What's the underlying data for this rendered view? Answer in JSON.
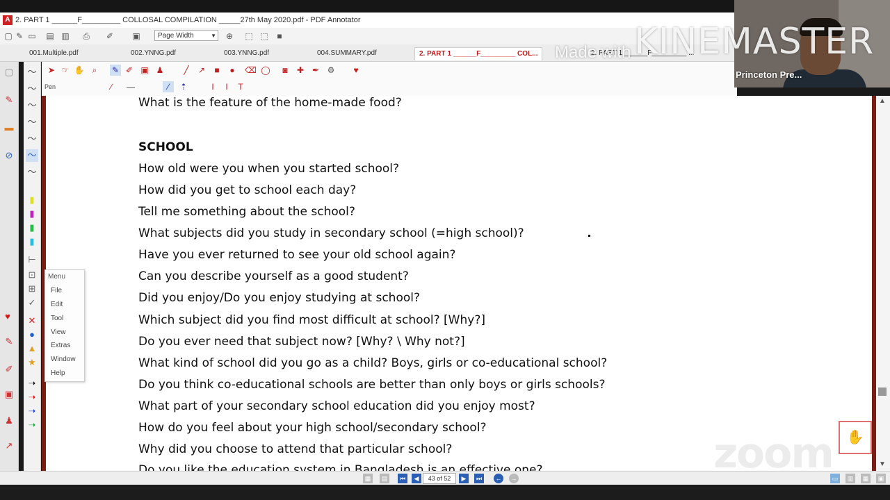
{
  "window": {
    "title": "2. PART 1 ______F_________ COLLOSAL COMPILATION _____27th  May  2020.pdf - PDF Annotator",
    "app_icon": "pdf-annotator-icon"
  },
  "quick_toolbar": {
    "zoom_mode": "Page Width"
  },
  "tabs": [
    {
      "label": "001.Multiple.pdf"
    },
    {
      "label": "002.YNNG.pdf"
    },
    {
      "label": "003.YNNG.pdf"
    },
    {
      "label": "004.SUMMARY.pdf"
    },
    {
      "label": "2. PART 1 ______F_________ COL..."
    },
    {
      "label": "2. PART 1 ______F_________ ..."
    }
  ],
  "tool_options": {
    "current_tool": "Pen"
  },
  "document": {
    "lines": [
      {
        "text": "What is the feature of the home-made food?"
      },
      {
        "text": "SCHOOL",
        "heading": true
      },
      {
        "text": "How old were you when you started school?"
      },
      {
        "text": "How did you get to school each day?"
      },
      {
        "text": "Tell me something about the school?"
      },
      {
        "text": "What subjects did you study in secondary school (=high school)?"
      },
      {
        "text": "Have you ever returned to see your old school again?"
      },
      {
        "text": "Can you describe yourself as a good student?"
      },
      {
        "text": "Did you enjoy/Do you enjoy studying at school?"
      },
      {
        "text": "Which subject did you find most difficult at school? [Why?]"
      },
      {
        "text": "Do you ever need that subject now? [Why? \\ Why not?]"
      },
      {
        "text": "What kind of school did you go as a child? Boys, girls or co-educational school?"
      },
      {
        "text": "Do you think co-educational schools are better than only boys or girls schools?"
      },
      {
        "text": "What part of your secondary school education did you enjoy most?"
      },
      {
        "text": "How do you feel about your high school/secondary school?"
      },
      {
        "text": "Why did you choose to attend that particular school?"
      },
      {
        "text": "Do you like the education system in Bangladesh is an effective one?"
      }
    ]
  },
  "context_menu": {
    "header": "Menu",
    "items": [
      "File",
      "Edit",
      "Tool",
      "View",
      "Extras",
      "Window",
      "Help"
    ]
  },
  "statusbar": {
    "page_indicator": "43 of 52"
  },
  "overlay": {
    "participant_name": "Princeton Pre...",
    "watermark_small": "Made with",
    "watermark_big": "KINEMASTER",
    "zoom_logo": "zoom"
  },
  "colors": {
    "page_border": "#7a1d12",
    "accent_red": "#c01818",
    "nav_blue": "#2b5fb4"
  }
}
